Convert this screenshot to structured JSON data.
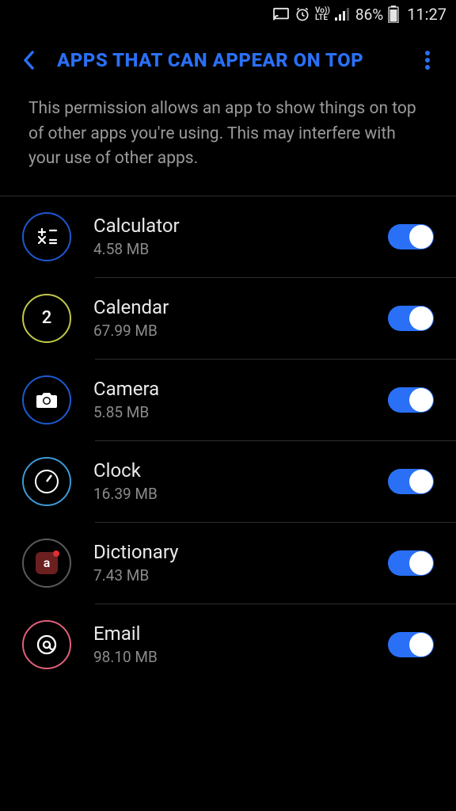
{
  "statusBar": {
    "battery": "86%",
    "time": "11:27"
  },
  "header": {
    "title": "APPS THAT CAN APPEAR ON TOP"
  },
  "description": "This permission allows an app to show things on top of other apps you're using. This may interfere with your use of other apps.",
  "apps": [
    {
      "name": "Calculator",
      "size": "4.58 MB",
      "iconClass": "ic-calc",
      "iconKey": "calculator",
      "enabled": true
    },
    {
      "name": "Calendar",
      "size": "67.99 MB",
      "iconClass": "ic-cal",
      "iconKey": "calendar",
      "enabled": true
    },
    {
      "name": "Camera",
      "size": "5.85 MB",
      "iconClass": "ic-cam",
      "iconKey": "camera",
      "enabled": true
    },
    {
      "name": "Clock",
      "size": "16.39 MB",
      "iconClass": "ic-clock",
      "iconKey": "clock",
      "enabled": true
    },
    {
      "name": "Dictionary",
      "size": "7.43 MB",
      "iconClass": "ic-dict",
      "iconKey": "dictionary",
      "enabled": true
    },
    {
      "name": "Email",
      "size": "98.10 MB",
      "iconClass": "ic-email",
      "iconKey": "email",
      "enabled": true
    }
  ],
  "calendarDay": "2"
}
